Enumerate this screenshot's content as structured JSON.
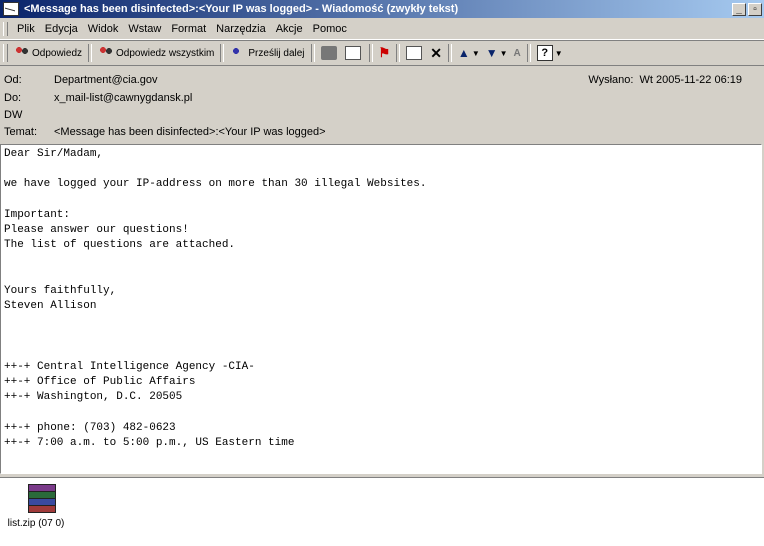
{
  "window": {
    "title": "<Message has been disinfected>:<Your IP was logged> - Wiadomość (zwykły tekst)",
    "controls": [
      "_",
      "▫"
    ]
  },
  "menu": [
    "Plik",
    "Edycja",
    "Widok",
    "Wstaw",
    "Format",
    "Narzędzia",
    "Akcje",
    "Pomoc"
  ],
  "toolbar": {
    "reply": "Odpowiedz",
    "reply_all": "Odpowiedz wszystkim",
    "forward": "Prześlij dalej"
  },
  "header": {
    "from_label": "Od:",
    "from": "Department@cia.gov",
    "to_label": "Do:",
    "to": "x_mail-list@cawnygdansk.pl",
    "cc_label": "DW",
    "cc": "",
    "subject_label": "Temat:",
    "subject": "<Message has been disinfected>:<Your IP was logged>",
    "sent_label": "Wysłano:",
    "sent": "Wt 2005-11-22 06:19"
  },
  "body_text": "Dear Sir/Madam,\n\nwe have logged your IP-address on more than 30 illegal Websites.\n\nImportant:\nPlease answer our questions!\nThe list of questions are attached.\n\n\nYours faithfully,\nSteven Allison\n\n\n\n++-+ Central Intelligence Agency -CIA-\n++-+ Office of Public Affairs\n++-+ Washington, D.C. 20505\n\n++-+ phone: (703) 482-0623\n++-+ 7:00 a.m. to 5:00 p.m., US Eastern time",
  "attachment": {
    "name": "list.zip (07 0)",
    "icon": "winrar-archive-icon"
  }
}
